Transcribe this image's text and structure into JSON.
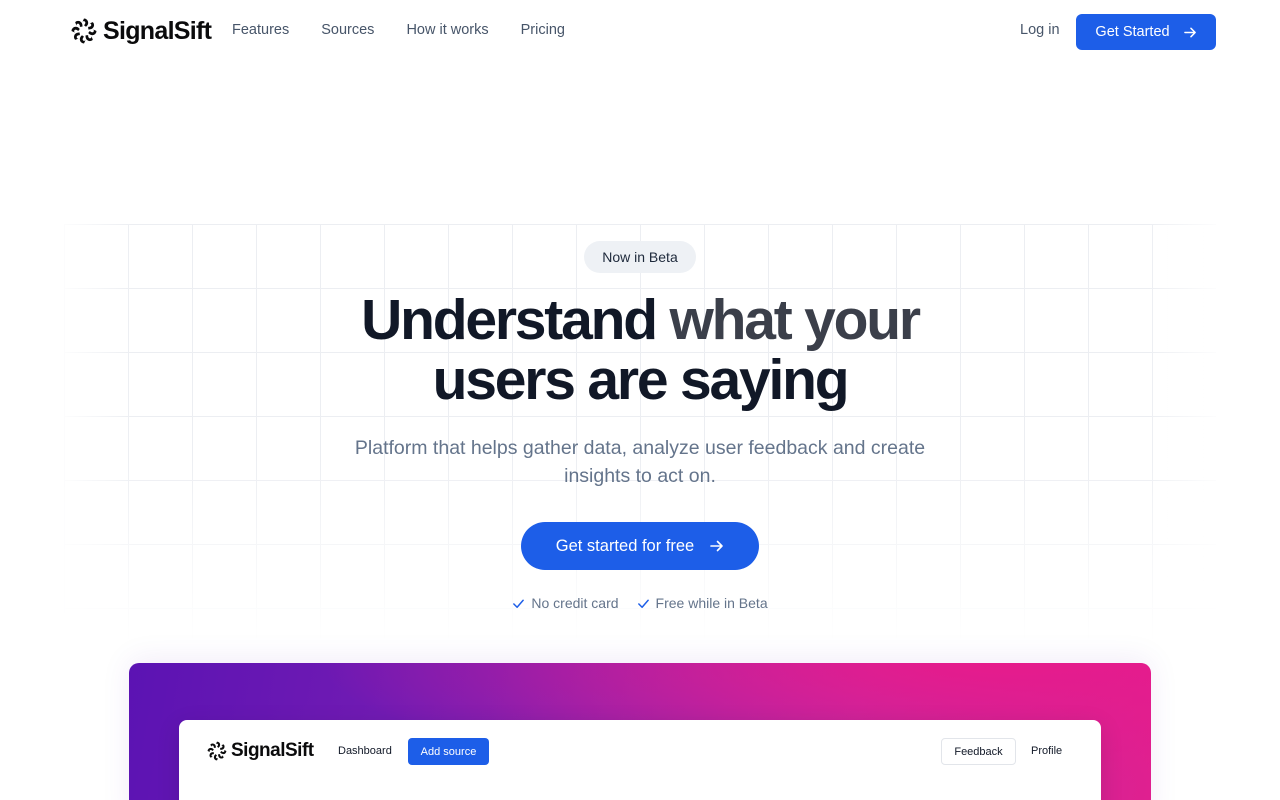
{
  "brand": {
    "name": "SignalSift",
    "icon": "swirl-logo-icon"
  },
  "nav": {
    "links": [
      "Features",
      "Sources",
      "How it works",
      "Pricing"
    ],
    "login": "Log in",
    "cta": "Get Started"
  },
  "hero": {
    "badge": "Now in Beta",
    "headline_part1": "Understand ",
    "headline_part2": "what your",
    "headline_part3": "users are saying",
    "subtitle": "Platform that helps gather data, analyze user feedback and create insights to act on.",
    "cta": "Get started for free",
    "checks": [
      "No credit card",
      "Free while in Beta"
    ]
  },
  "preview": {
    "brand": "SignalSift",
    "links": {
      "dashboard": "Dashboard",
      "profile": "Profile"
    },
    "add_source": "Add source",
    "feedback": "Feedback"
  },
  "colors": {
    "primary": "#1d5ee8",
    "text": "#111827",
    "muted": "#64748b",
    "gradient_start": "#5b13b3",
    "gradient_end": "#e0208f"
  }
}
